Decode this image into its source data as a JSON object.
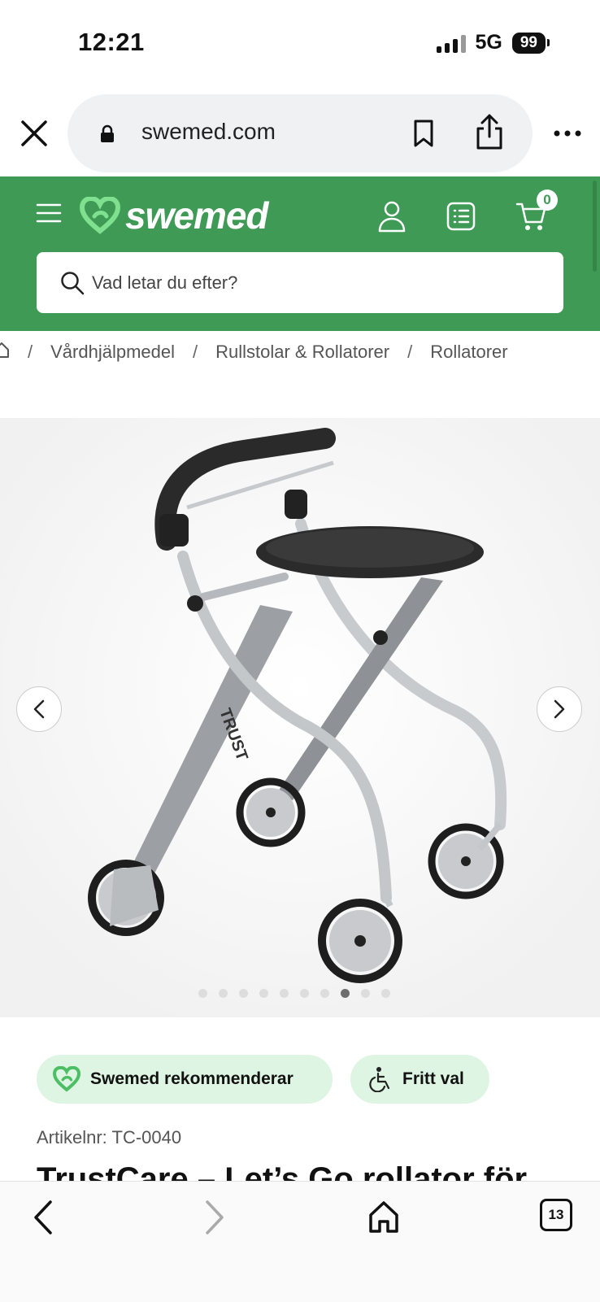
{
  "status_bar": {
    "time": "12:21",
    "network": "5G",
    "battery": "99"
  },
  "browser": {
    "url": "swemed.com",
    "tab_count": "13"
  },
  "header": {
    "logo_text": "swemed",
    "cart_count": "0",
    "search_placeholder": "Vad letar du efter?"
  },
  "breadcrumb": [
    "Vårdhjälpmedel",
    "Rullstolar & Rollatorer",
    "Rollatorer"
  ],
  "gallery": {
    "dot_count": 10,
    "active_index": 7,
    "brand_on_frame": "TRUST"
  },
  "badges": {
    "recommend": "Swemed rekommenderar",
    "free_choice": "Fritt val"
  },
  "product": {
    "article_number": "Artikelnr: TC-0040",
    "title": "TrustCare – Let’s Go rollator för"
  },
  "colors": {
    "brand_green": "#3f9a56",
    "badge_bg": "#dff5e3",
    "logo_heart": "#7fe08f"
  }
}
